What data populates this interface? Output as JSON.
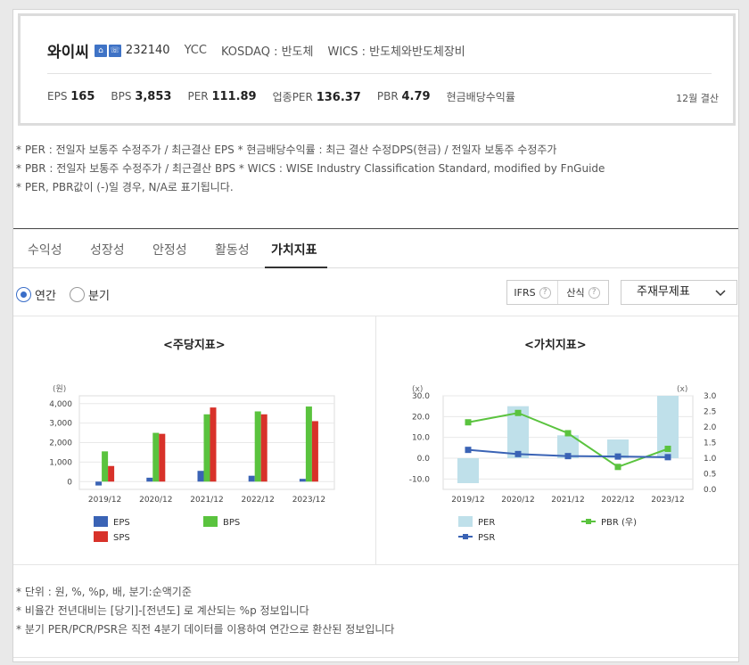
{
  "header": {
    "corp_name": "와이씨",
    "icon1": "home-icon",
    "icon2": "ir-icon",
    "code": "232140",
    "ticker": "YCC",
    "market": "KOSDAQ : 반도체",
    "wics": "WICS : 반도체와반도체장비",
    "metrics": [
      {
        "label": "EPS",
        "value": "165"
      },
      {
        "label": "BPS",
        "value": "3,853"
      },
      {
        "label": "PER",
        "value": "111.89"
      },
      {
        "label": "업종PER",
        "value": "136.37"
      },
      {
        "label": "PBR",
        "value": "4.79"
      },
      {
        "label": "현금배당수익률",
        "value": ""
      }
    ],
    "settlement": "12월 결산"
  },
  "notes_top": [
    "* PER : 전일자 보통주 수정주가 / 최근결산 EPS * 현금배당수익률 : 최근 결산 수정DPS(현금) / 전일자 보통주 수정주가",
    "* PBR : 전일자 보통주 수정주가 / 최근결산 BPS * WICS : WISE Industry Classification Standard, modified by FnGuide",
    "* PER, PBR값이 (-)일 경우, N/A로 표기됩니다."
  ],
  "tabs": [
    {
      "label": "수익성",
      "active": false
    },
    {
      "label": "성장성",
      "active": false
    },
    {
      "label": "안정성",
      "active": false
    },
    {
      "label": "활동성",
      "active": false
    },
    {
      "label": "가치지표",
      "active": true
    }
  ],
  "period": {
    "annual": "연간",
    "quarter": "분기",
    "selected": "annual"
  },
  "buttons": {
    "ifrs": "IFRS",
    "calc": "산식",
    "qmark": "?"
  },
  "select": {
    "value": "주재무제표",
    "chevron": "chevron-down-icon"
  },
  "chart_data": [
    {
      "type": "bar",
      "title": "<주당지표>",
      "ylabel": "(원)",
      "ylim": [
        -400,
        4400
      ],
      "yticks": [
        0,
        1000,
        2000,
        3000,
        4000
      ],
      "ytick_labels": [
        "0",
        "1,000",
        "2,000",
        "3,000",
        "4,000"
      ],
      "categories": [
        "2019/12",
        "2020/12",
        "2021/12",
        "2022/12",
        "2023/12"
      ],
      "series": [
        {
          "name": "EPS",
          "color": "#3a63b5",
          "values": [
            -200,
            200,
            550,
            300,
            140
          ]
        },
        {
          "name": "BPS",
          "color": "#5ac33e",
          "values": [
            1550,
            2500,
            3450,
            3600,
            3850
          ]
        },
        {
          "name": "SPS",
          "color": "#d8322a",
          "values": [
            800,
            2450,
            3800,
            3450,
            3100
          ]
        }
      ],
      "legend": [
        {
          "name": "EPS",
          "color": "#3a63b5"
        },
        {
          "name": "BPS",
          "color": "#5ac33e"
        },
        {
          "name": "SPS",
          "color": "#d8322a"
        }
      ]
    },
    {
      "type": "bar+line",
      "title": "<가치지표>",
      "ylabel_left": "(x)",
      "ylabel_right": "(x)",
      "ylim_left": [
        -15,
        30
      ],
      "yticks_left": [
        -10,
        0,
        10,
        20,
        30
      ],
      "ytick_labels_left": [
        "-10.0",
        "0.0",
        "10.0",
        "20.0",
        "30.0"
      ],
      "ylim_right": [
        0,
        3
      ],
      "yticks_right": [
        0,
        0.5,
        1,
        1.5,
        2,
        2.5,
        3
      ],
      "ytick_labels_right": [
        "0.0",
        "0.5",
        "1.0",
        "1.5",
        "2.0",
        "2.5",
        "3.0"
      ],
      "categories": [
        "2019/12",
        "2020/12",
        "2021/12",
        "2022/12",
        "2023/12"
      ],
      "series": [
        {
          "name": "PER",
          "type": "bar",
          "axis": "left",
          "color": "#bfe0ea",
          "values": [
            -12,
            25,
            11,
            9,
            30
          ]
        },
        {
          "name": "PBR (우)",
          "type": "line",
          "axis": "right",
          "color": "#5ac33e",
          "values": [
            2.15,
            2.45,
            1.8,
            0.72,
            1.3
          ]
        },
        {
          "name": "PSR",
          "type": "line",
          "axis": "left",
          "color": "#3a63b5",
          "values": [
            4,
            2,
            1,
            0.8,
            0.5
          ]
        }
      ],
      "legend": [
        {
          "name": "PER",
          "color": "#bfe0ea"
        },
        {
          "name": "PBR (우)",
          "color": "#5ac33e"
        },
        {
          "name": "PSR",
          "color": "#3a63b5"
        }
      ]
    }
  ],
  "notes_bottom": [
    "* 단위 : 원, %, %p, 배, 분기:순액기준",
    "* 비율간 전년대비는 [당기]-[전년도] 로 계산되는 %p 정보입니다",
    "* 분기 PER/PCR/PSR은 직전 4분기 데이터를 이용하여 연간으로 환산된 정보입니다"
  ]
}
